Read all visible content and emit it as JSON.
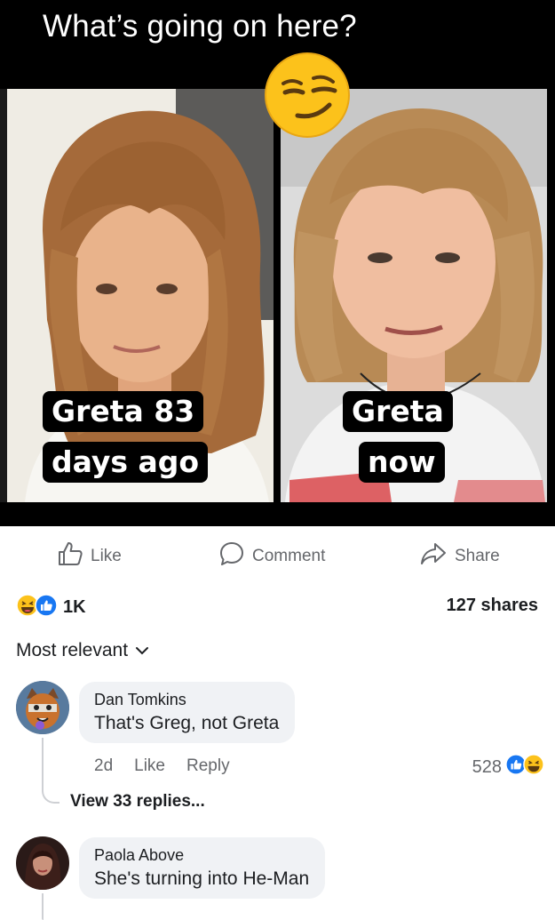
{
  "post": {
    "meme_title": "What’s going on here?",
    "left_caption_line1": "Greta 83",
    "left_caption_line2": "days ago",
    "right_caption_line1": "Greta",
    "right_caption_line2": "now",
    "emoji": "smirking-face"
  },
  "actions": {
    "like_label": "Like",
    "comment_label": "Comment",
    "share_label": "Share"
  },
  "summary": {
    "reaction_icons": [
      "laughing-emoji",
      "like-thumb"
    ],
    "reaction_count": "1K",
    "shares": "127 shares"
  },
  "sort": {
    "label": "Most relevant"
  },
  "comments": [
    {
      "author": "Dan Tomkins",
      "text": "That's Greg, not Greta",
      "age": "2d",
      "like_label": "Like",
      "reply_label": "Reply",
      "reaction_count": "528",
      "view_replies": "View 33 replies..."
    },
    {
      "author": "Paola Above",
      "text": "She's turning into He-Man"
    }
  ],
  "colors": {
    "facebook_blue": "#1877f2",
    "muted_text": "#65676b",
    "bubble_bg": "#f0f2f5",
    "emoji_yellow": "#fcc21b"
  }
}
